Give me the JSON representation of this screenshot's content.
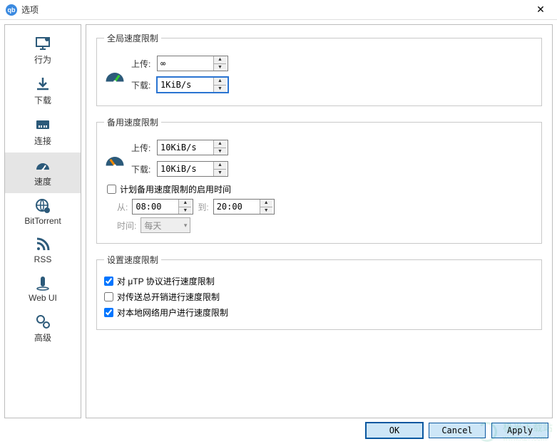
{
  "window": {
    "title": "选项"
  },
  "sidebar": {
    "items": [
      {
        "label": "行为"
      },
      {
        "label": "下载"
      },
      {
        "label": "连接"
      },
      {
        "label": "速度"
      },
      {
        "label": "BitTorrent"
      },
      {
        "label": "RSS"
      },
      {
        "label": "Web UI"
      },
      {
        "label": "高级"
      }
    ]
  },
  "global": {
    "legend": "全局速度限制",
    "upload_label": "上传:",
    "download_label": "下载:",
    "upload_value": "∞",
    "download_value": "1KiB/s"
  },
  "alt": {
    "legend": "备用速度限制",
    "upload_label": "上传:",
    "download_label": "下载:",
    "upload_value": "10KiB/s",
    "download_value": "10KiB/s",
    "schedule_label": "计划备用速度限制的启用时间",
    "from_label": "从:",
    "from_value": "08:00",
    "to_label": "到:",
    "to_value": "20:00",
    "when_label": "时间:",
    "when_value": "每天"
  },
  "opts": {
    "legend": "设置速度限制",
    "utp": "对 μTP 协议进行速度限制",
    "overhead": "对传送总开销进行速度限制",
    "lan": "对本地网络用户进行速度限制"
  },
  "buttons": {
    "ok": "OK",
    "cancel": "Cancel",
    "apply": "Apply"
  },
  "watermark": {
    "text": "极光下载站",
    "url": "www.x27.com"
  }
}
